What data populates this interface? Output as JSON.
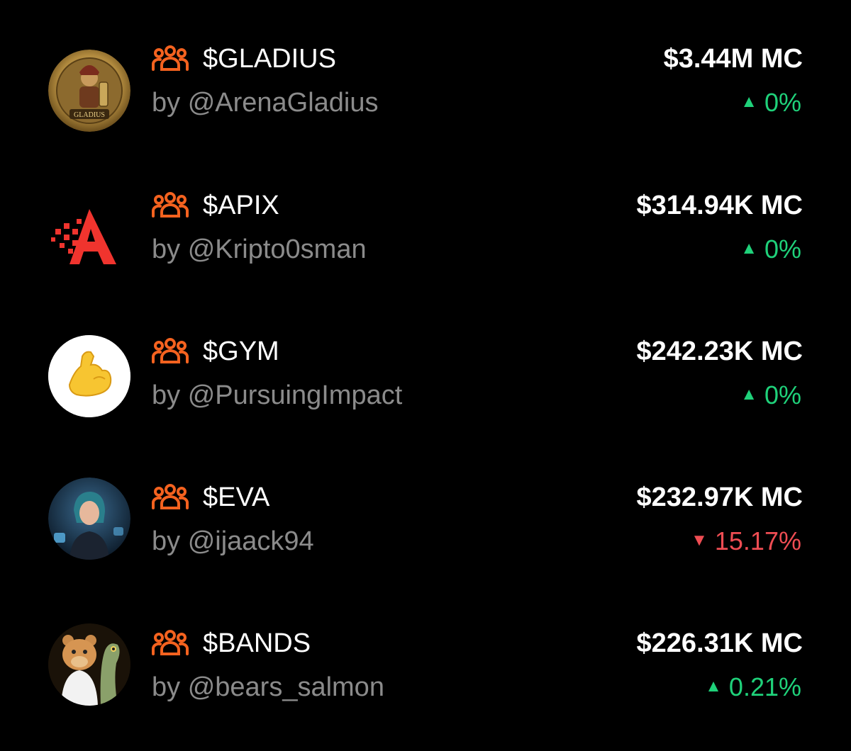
{
  "accent_color": "#f4621f",
  "up_color": "#1fd17a",
  "down_color": "#ef4d53",
  "tokens": [
    {
      "ticker": "$GLADIUS",
      "creator": "by @ArenaGladius",
      "market_cap": "$3.44M MC",
      "change_arrow": "▲",
      "change": "0%",
      "direction": "up",
      "avatar_icon": "gladius-coin-icon",
      "avatar_text": "GLADIUS"
    },
    {
      "ticker": "$APIX",
      "creator": "by @Kripto0sman",
      "market_cap": "$314.94K MC",
      "change_arrow": "▲",
      "change": "0%",
      "direction": "up",
      "avatar_icon": "apix-letter-a-icon"
    },
    {
      "ticker": "$GYM",
      "creator": "by @PursuingImpact",
      "market_cap": "$242.23K MC",
      "change_arrow": "▲",
      "change": "0%",
      "direction": "up",
      "avatar_icon": "flexed-biceps-icon"
    },
    {
      "ticker": "$EVA",
      "creator": "by @ijaack94",
      "market_cap": "$232.97K MC",
      "change_arrow": "▼",
      "change": "15.17%",
      "direction": "down",
      "avatar_icon": "eva-character-icon"
    },
    {
      "ticker": "$BANDS",
      "creator": "by @bears_salmon",
      "market_cap": "$226.31K MC",
      "change_arrow": "▲",
      "change": "0.21%",
      "direction": "up",
      "avatar_icon": "bear-and-salmon-icon"
    }
  ]
}
